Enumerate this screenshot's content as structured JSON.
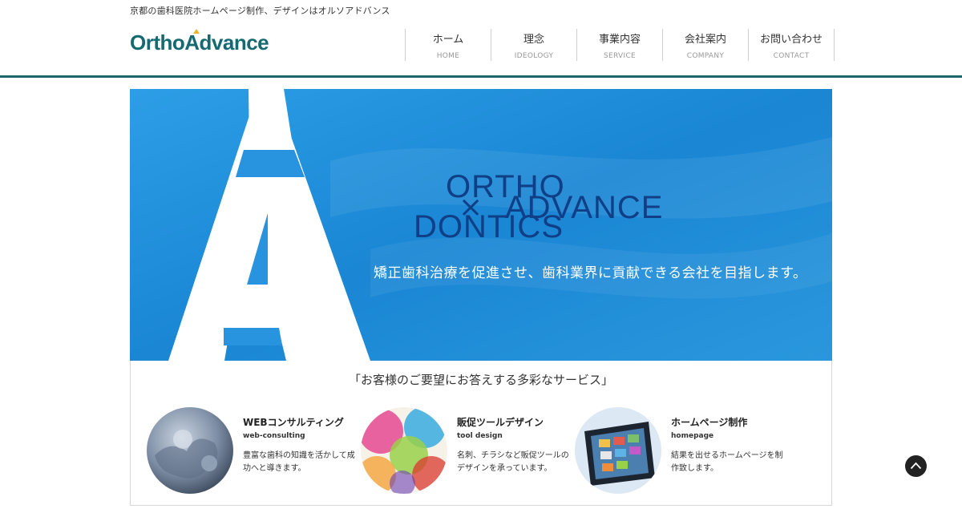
{
  "header": {
    "tagline": "京都の歯科医院ホームページ制作、デザインはオルソアドバンス",
    "logo_text": "OrthoAdvance",
    "nav": [
      {
        "jp": "ホーム",
        "en": "HOME"
      },
      {
        "jp": "理念",
        "en": "IDEOLOGY"
      },
      {
        "jp": "事業内容",
        "en": "SERVICE"
      },
      {
        "jp": "会社案内",
        "en": "COMPANY"
      },
      {
        "jp": "お問い合わせ",
        "en": "CONTACT"
      }
    ]
  },
  "hero": {
    "line1": "ORTHO",
    "line2": "DONTICS",
    "times": "×",
    "advance": "ADVANCE",
    "slogan": "矯正歯科治療を促進させ、歯科業界に貢献できる会社を目指します。"
  },
  "services": {
    "heading": "「お客様のご要望にお答えする多彩なサービス」",
    "items": [
      {
        "title": "WEBコンサルティング",
        "sub": "web-consulting",
        "desc": "豊富な歯科の知識を活かして成功へと導きます。"
      },
      {
        "title": "販促ツールデザイン",
        "sub": "tool design",
        "desc": "名刺、チラシなど販促ツールのデザインを承っています。"
      },
      {
        "title": "ホームページ制作",
        "sub": "homepage",
        "desc": "結果を出せるホームページを制作致します。"
      }
    ]
  },
  "colors": {
    "brand": "#156a72",
    "accent": "#e8b431",
    "hero_blue": "#1e8fd8",
    "hero_text": "#0f3f86"
  }
}
